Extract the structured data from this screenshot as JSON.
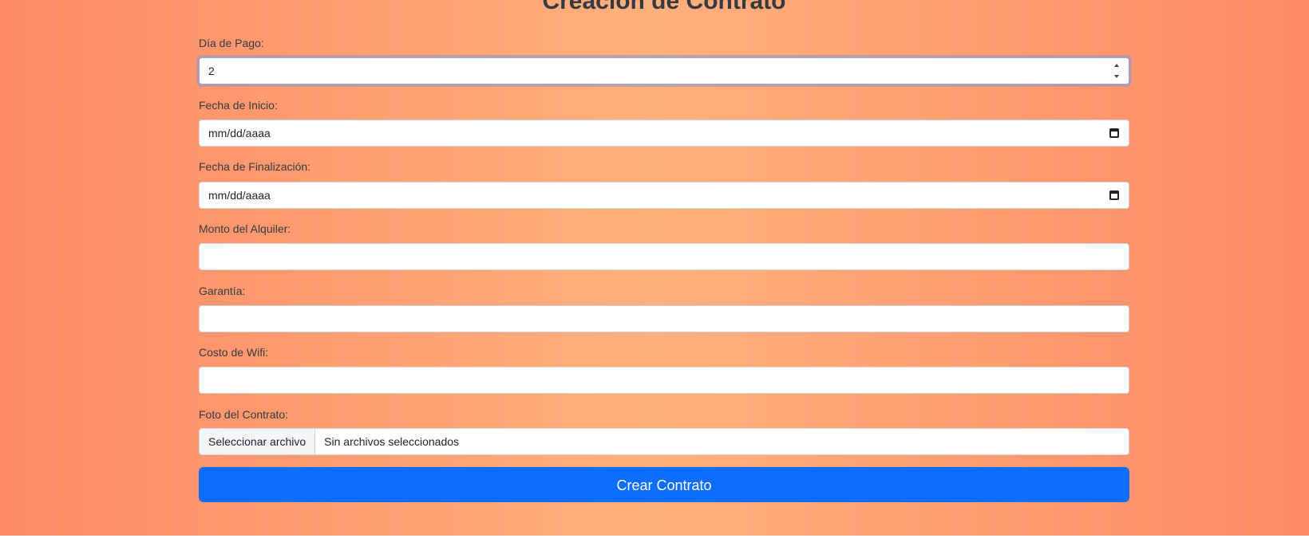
{
  "page": {
    "title": "Creación de Contrato"
  },
  "form": {
    "payment_day": {
      "label": "Día de Pago:",
      "value": "2"
    },
    "start_date": {
      "label": "Fecha de Inicio:",
      "placeholder": "mm/dd/aaaa"
    },
    "end_date": {
      "label": "Fecha de Finalización:",
      "placeholder": "mm/dd/aaaa"
    },
    "rent_amount": {
      "label": "Monto del Alquiler:",
      "value": ""
    },
    "deposit": {
      "label": "Garantía:",
      "value": ""
    },
    "wifi_cost": {
      "label": "Costo de Wifi:",
      "value": ""
    },
    "contract_photo": {
      "label": "Foto del Contrato:",
      "button_label": "Seleccionar archivo",
      "status": "Sin archivos seleccionados"
    },
    "submit_label": "Crear Contrato"
  },
  "icons": {
    "date_picker": "calendar-icon",
    "number_spinner": "spinner-icon"
  },
  "colors": {
    "background_edge": "#ff8a65",
    "background_center": "#ffb07d",
    "submit_button": "#0d6efd"
  }
}
